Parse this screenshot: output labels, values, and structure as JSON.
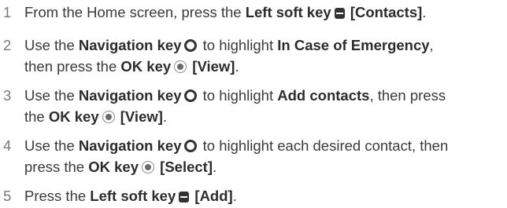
{
  "steps": [
    {
      "number": "1",
      "t1": "From the Home screen, press the ",
      "b1": "Left soft key",
      "b2": "[Contacts]",
      "t2": "."
    },
    {
      "number": "2",
      "t1": "Use the ",
      "b1": "Navigation key",
      "t2": " to highlight ",
      "b2": "In Case of Emergency",
      "t3": ",",
      "t4": "then press the ",
      "b3": "OK key",
      "b4": "[View]",
      "t5": "."
    },
    {
      "number": "3",
      "t1": "Use the ",
      "b1": "Navigation key",
      "t2": " to highlight ",
      "b2": "Add contacts",
      "t3": ", then press",
      "t4": "the ",
      "b3": "OK key",
      "b4": "[View]",
      "t5": "."
    },
    {
      "number": "4",
      "t1": "Use the ",
      "b1": "Navigation key",
      "t2": " to highlight each desired contact, then",
      "t4": "press the ",
      "b3": "OK key",
      "b4": "[Select]",
      "t5": "."
    },
    {
      "number": "5",
      "t1": "Press the ",
      "b1": "Left soft key",
      "b2": "[Add]",
      "t2": "."
    }
  ],
  "icons": {
    "left_soft_key": "left-soft-key-icon",
    "navigation_key": "navigation-key-icon",
    "ok_key": "ok-key-icon"
  }
}
